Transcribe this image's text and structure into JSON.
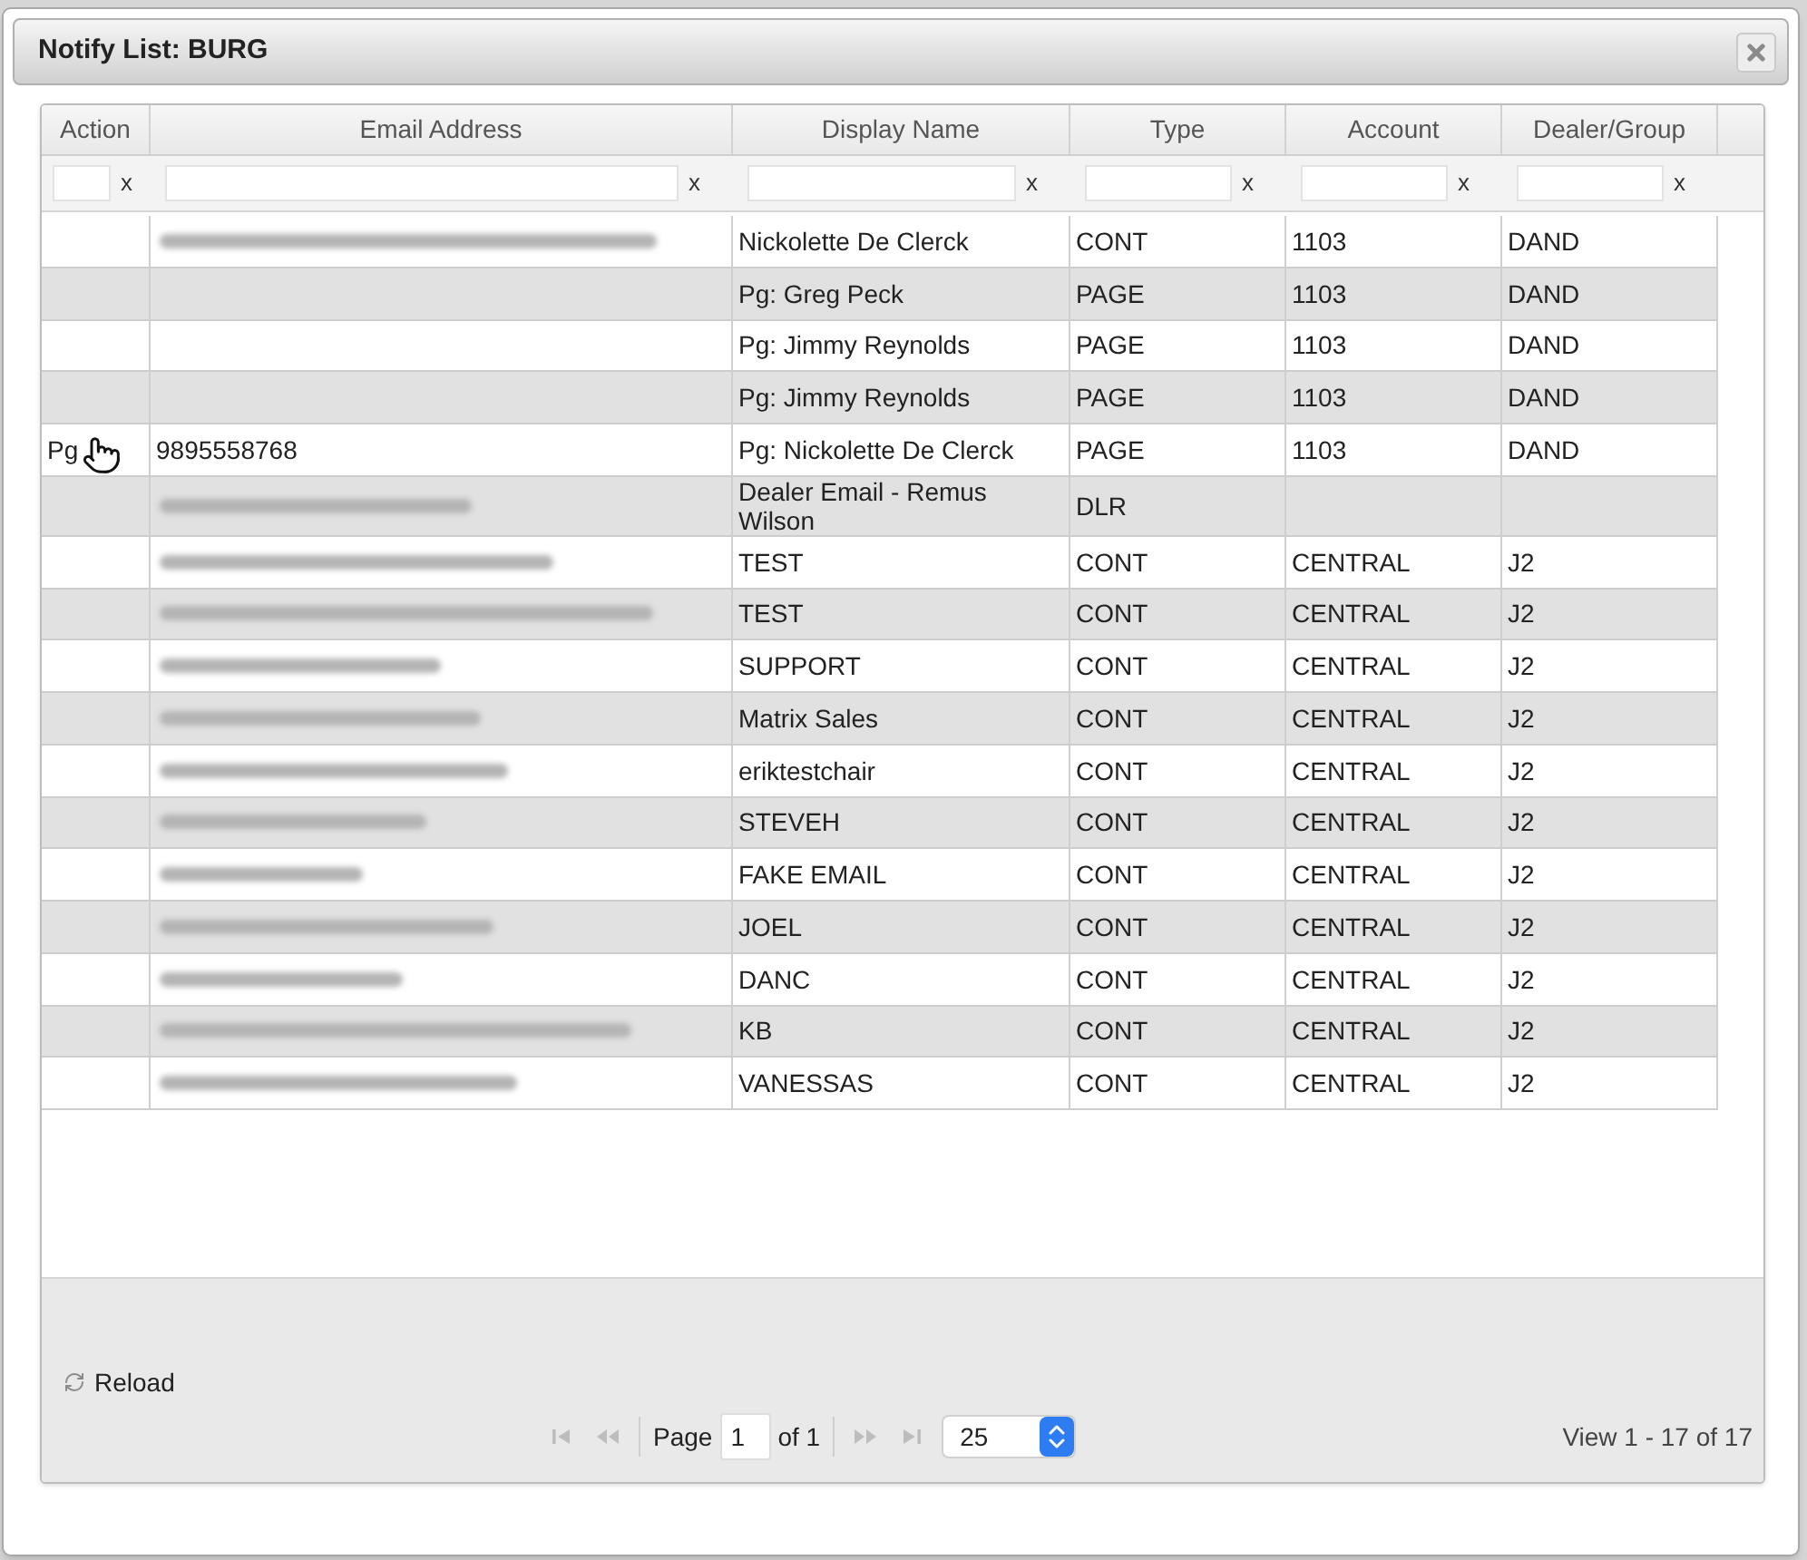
{
  "dialog": {
    "title": "Notify List: BURG"
  },
  "grid": {
    "columns": [
      {
        "label": "Action"
      },
      {
        "label": "Email Address"
      },
      {
        "label": "Display Name"
      },
      {
        "label": "Type"
      },
      {
        "label": "Account"
      },
      {
        "label": "Dealer/Group"
      }
    ],
    "filters": [
      {
        "clear": "x"
      },
      {
        "clear": "x"
      },
      {
        "clear": "x"
      },
      {
        "clear": "x"
      },
      {
        "clear": "x"
      },
      {
        "clear": "x"
      }
    ],
    "rows": [
      {
        "email_blurred": true,
        "hovered": false,
        "display_name": "Nickolette De Clerck",
        "type": "CONT",
        "account": "1103",
        "dealer_group": "DAND"
      },
      {
        "email_blurred": false,
        "hovered": false,
        "display_name": "Pg: Greg Peck",
        "type": "PAGE",
        "account": "1103",
        "dealer_group": "DAND"
      },
      {
        "email_blurred": false,
        "hovered": false,
        "display_name": "Pg: Jimmy Reynolds",
        "type": "PAGE",
        "account": "1103",
        "dealer_group": "DAND"
      },
      {
        "email_blurred": false,
        "hovered": false,
        "display_name": "Pg: Jimmy Reynolds",
        "type": "PAGE",
        "account": "1103",
        "dealer_group": "DAND"
      },
      {
        "action": "Pg",
        "email": "9895558768",
        "email_blurred": false,
        "hovered": true,
        "display_name": "Pg: Nickolette De Clerck",
        "type": "PAGE",
        "account": "1103",
        "dealer_group": "DAND"
      },
      {
        "email_blurred": true,
        "hovered": false,
        "display_name": "Dealer Email - Remus Wilson",
        "type": "DLR"
      },
      {
        "email_blurred": true,
        "hovered": false,
        "display_name": "TEST",
        "type": "CONT",
        "account": "CENTRAL",
        "dealer_group": "J2"
      },
      {
        "email_blurred": true,
        "hovered": false,
        "display_name": "TEST",
        "type": "CONT",
        "account": "CENTRAL",
        "dealer_group": "J2"
      },
      {
        "email_blurred": true,
        "hovered": false,
        "display_name": "SUPPORT",
        "type": "CONT",
        "account": "CENTRAL",
        "dealer_group": "J2"
      },
      {
        "email_blurred": true,
        "hovered": false,
        "display_name": "Matrix Sales",
        "type": "CONT",
        "account": "CENTRAL",
        "dealer_group": "J2"
      },
      {
        "email_blurred": true,
        "hovered": false,
        "display_name": "eriktestchair",
        "type": "CONT",
        "account": "CENTRAL",
        "dealer_group": "J2"
      },
      {
        "email_blurred": true,
        "hovered": false,
        "display_name": "STEVEH",
        "type": "CONT",
        "account": "CENTRAL",
        "dealer_group": "J2"
      },
      {
        "email_blurred": true,
        "hovered": false,
        "display_name": "FAKE EMAIL",
        "type": "CONT",
        "account": "CENTRAL",
        "dealer_group": "J2"
      },
      {
        "email_blurred": true,
        "hovered": false,
        "display_name": "JOEL",
        "type": "CONT",
        "account": "CENTRAL",
        "dealer_group": "J2"
      },
      {
        "email_blurred": true,
        "hovered": false,
        "display_name": "DANC",
        "type": "CONT",
        "account": "CENTRAL",
        "dealer_group": "J2"
      },
      {
        "email_blurred": true,
        "hovered": false,
        "display_name": "KB",
        "type": "CONT",
        "account": "CENTRAL",
        "dealer_group": "J2"
      },
      {
        "email_blurred": true,
        "hovered": false,
        "display_name": "VANESSAS",
        "type": "CONT",
        "account": "CENTRAL",
        "dealer_group": "J2"
      }
    ]
  },
  "footer": {
    "reload": "Reload",
    "nav_buttons": [
      {
        "kind": "first",
        "disabled": true
      },
      {
        "kind": "prev",
        "disabled": true
      },
      {
        "kind": "next",
        "disabled": true
      },
      {
        "kind": "last",
        "disabled": true
      }
    ],
    "page_label": "Page",
    "page": "1",
    "page_total": "of 1",
    "page_size": "25",
    "view": "View 1 - 17 of 17"
  }
}
